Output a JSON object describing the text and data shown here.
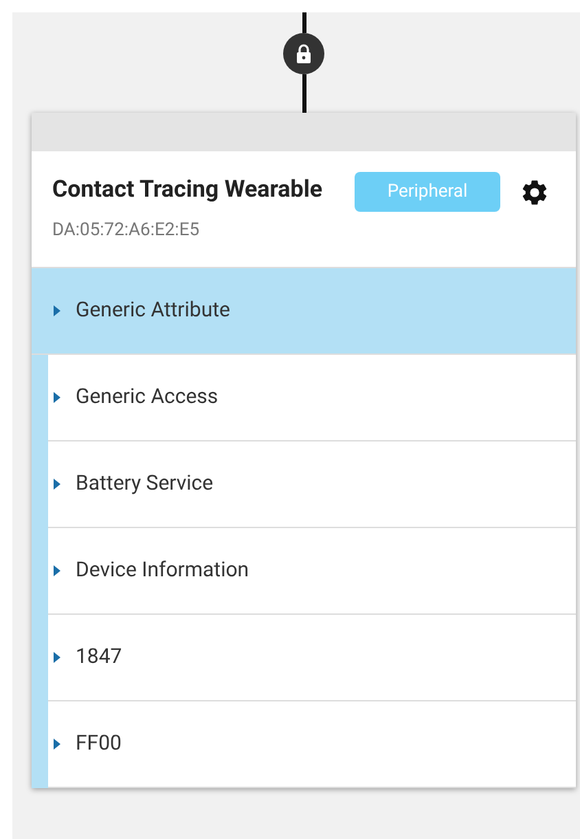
{
  "device": {
    "name": "Contact Tracing Wearable",
    "address": "DA:05:72:A6:E2:E5",
    "role": "Peripheral",
    "locked": true
  },
  "services": [
    {
      "name": "Generic Attribute",
      "selected": true,
      "expanded": false
    },
    {
      "name": "Generic Access",
      "selected": false,
      "expanded": false
    },
    {
      "name": "Battery Service",
      "selected": false,
      "expanded": false
    },
    {
      "name": "Device Information",
      "selected": false,
      "expanded": false
    },
    {
      "name": "1847",
      "selected": false,
      "expanded": false
    },
    {
      "name": "FF00",
      "selected": false,
      "expanded": false
    }
  ]
}
